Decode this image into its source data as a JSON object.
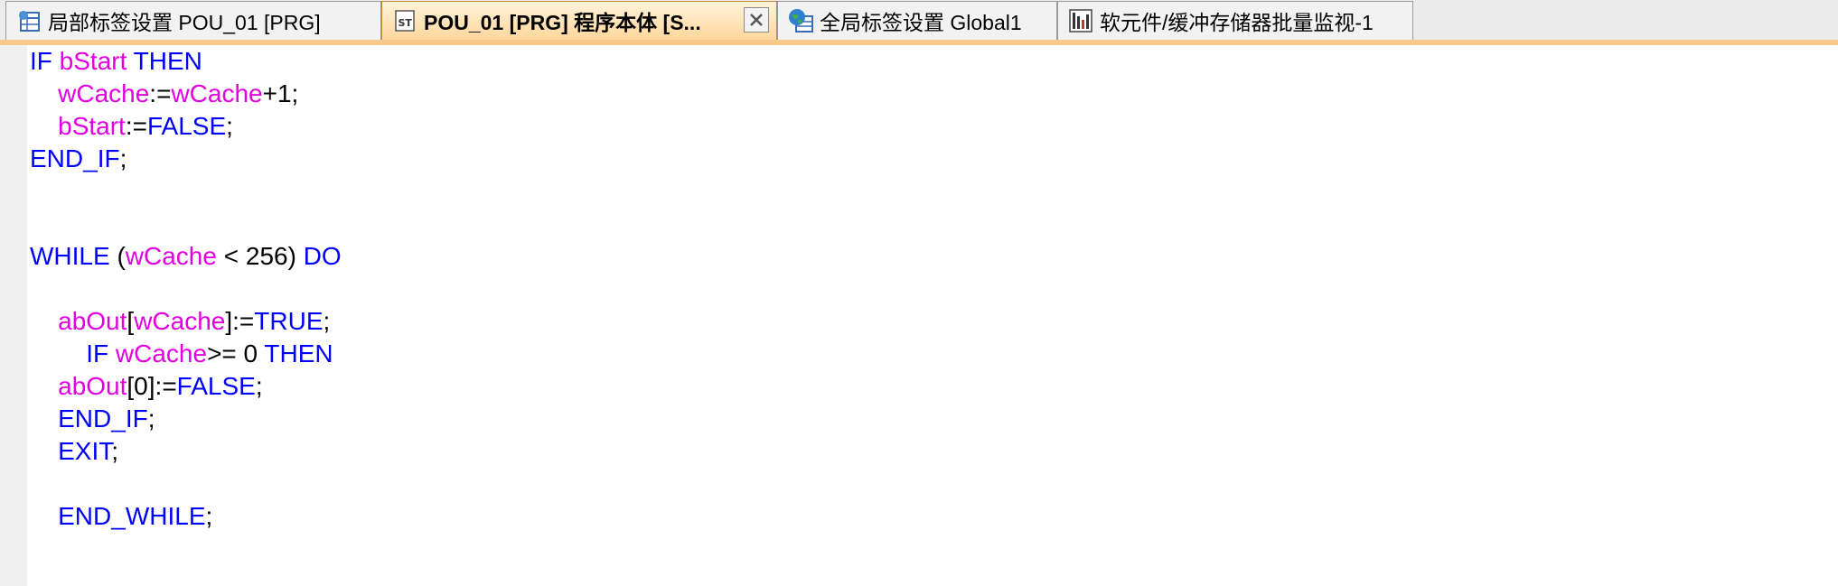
{
  "tabs": [
    {
      "label": "局部标签设置 POU_01 [PRG]",
      "icon": "table-icon",
      "active": false
    },
    {
      "label": "POU_01 [PRG] 程序本体 [S...",
      "icon": "st-icon",
      "active": true
    },
    {
      "label": "全局标签设置 Global1",
      "icon": "globe-table-icon",
      "active": false
    },
    {
      "label": "软元件/缓冲存储器批量监视-1",
      "icon": "monitor-icon",
      "active": false
    }
  ],
  "colors": {
    "keyword": "#0000ff",
    "variable": "#e000e0",
    "operator": "#000000",
    "active_tab": "#ffd79b"
  },
  "code": {
    "lines": [
      [
        {
          "t": "IF ",
          "c": "kw"
        },
        {
          "t": "bStart",
          "c": "var"
        },
        {
          "t": " THEN",
          "c": "kw"
        }
      ],
      [
        {
          "t": "    ",
          "c": "op"
        },
        {
          "t": "wCache",
          "c": "var"
        },
        {
          "t": ":=",
          "c": "op"
        },
        {
          "t": "wCache",
          "c": "var"
        },
        {
          "t": "+1;",
          "c": "op"
        }
      ],
      [
        {
          "t": "    ",
          "c": "op"
        },
        {
          "t": "bStart",
          "c": "var"
        },
        {
          "t": ":=",
          "c": "op"
        },
        {
          "t": "FALSE",
          "c": "kw"
        },
        {
          "t": ";",
          "c": "op"
        }
      ],
      [
        {
          "t": "END_IF",
          "c": "kw"
        },
        {
          "t": ";",
          "c": "op"
        }
      ],
      [],
      [],
      [
        {
          "t": "WHILE ",
          "c": "kw"
        },
        {
          "t": "(",
          "c": "op"
        },
        {
          "t": "wCache",
          "c": "var"
        },
        {
          "t": " < 256) ",
          "c": "op"
        },
        {
          "t": "DO",
          "c": "kw"
        }
      ],
      [],
      [
        {
          "t": "    ",
          "c": "op"
        },
        {
          "t": "abOut",
          "c": "var"
        },
        {
          "t": "[",
          "c": "op"
        },
        {
          "t": "wCache",
          "c": "var"
        },
        {
          "t": "]:=",
          "c": "op"
        },
        {
          "t": "TRUE",
          "c": "kw"
        },
        {
          "t": ";",
          "c": "op"
        }
      ],
      [
        {
          "t": "        ",
          "c": "op"
        },
        {
          "t": "IF ",
          "c": "kw"
        },
        {
          "t": "wCache",
          "c": "var"
        },
        {
          "t": ">= 0 ",
          "c": "op"
        },
        {
          "t": "THEN",
          "c": "kw"
        }
      ],
      [
        {
          "t": "    ",
          "c": "op"
        },
        {
          "t": "abOut",
          "c": "var"
        },
        {
          "t": "[0]:=",
          "c": "op"
        },
        {
          "t": "FALSE",
          "c": "kw"
        },
        {
          "t": ";",
          "c": "op"
        }
      ],
      [
        {
          "t": "    ",
          "c": "op"
        },
        {
          "t": "END_IF",
          "c": "kw"
        },
        {
          "t": ";",
          "c": "op"
        }
      ],
      [
        {
          "t": "    ",
          "c": "op"
        },
        {
          "t": "EXIT",
          "c": "kw"
        },
        {
          "t": ";",
          "c": "op"
        }
      ],
      [],
      [
        {
          "t": "    ",
          "c": "op"
        },
        {
          "t": "END_WHILE",
          "c": "kw"
        },
        {
          "t": ";",
          "c": "op"
        }
      ]
    ]
  }
}
